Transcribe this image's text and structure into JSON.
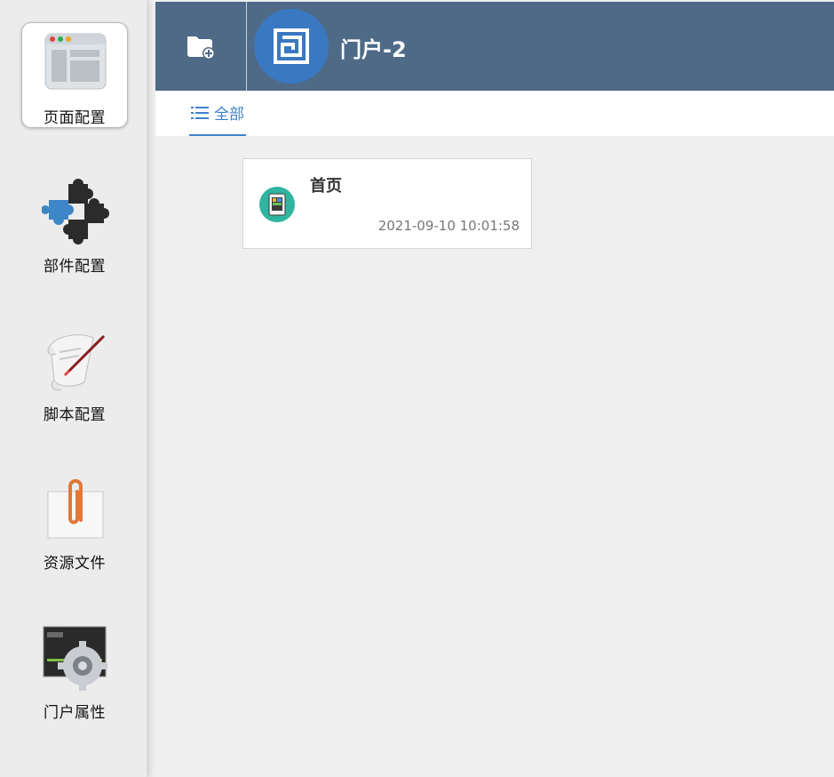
{
  "sidebar": {
    "items": [
      {
        "label": "页面配置",
        "icon": "browser-window-icon",
        "active": true
      },
      {
        "label": "部件配置",
        "icon": "puzzle-pieces-icon",
        "active": false
      },
      {
        "label": "脚本配置",
        "icon": "scroll-quill-icon",
        "active": false
      },
      {
        "label": "资源文件",
        "icon": "paperclip-icon",
        "active": false
      },
      {
        "label": "门户属性",
        "icon": "gear-monitor-icon",
        "active": false
      }
    ]
  },
  "header": {
    "add_icon": "folder-add-icon",
    "logo_icon": "portal-logo-icon",
    "title": "门户-2",
    "background": "#4e6a87",
    "logo_color": "#3a78c2"
  },
  "tabs": [
    {
      "label": "全部",
      "icon": "list-icon",
      "active": true,
      "color": "#3e82cc"
    }
  ],
  "pages": [
    {
      "title": "首页",
      "time": "2021-09-10 10:01:58",
      "icon": "tablet-icon",
      "icon_color": "#2fb5a0"
    }
  ]
}
